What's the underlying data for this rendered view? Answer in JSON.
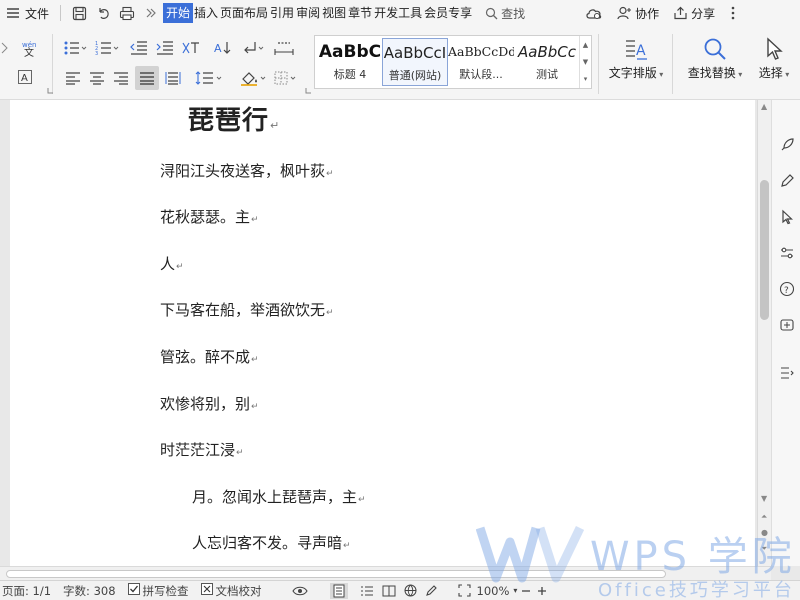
{
  "menubar": {
    "file_label": "文件",
    "tabs": [
      "开始",
      "插入",
      "页面布局",
      "引用",
      "审阅",
      "视图",
      "章节",
      "开发工具",
      "会员专享"
    ],
    "active_tab": "开始",
    "search_label": "查找",
    "collab_label": "协作",
    "share_label": "分享"
  },
  "ribbon": {
    "styles": [
      {
        "preview": "AaBbC",
        "name": "标题 4"
      },
      {
        "preview": "AaBbCcI",
        "name": "普通(网站)"
      },
      {
        "preview": "AaBbCcDd",
        "name": "默认段..."
      },
      {
        "preview": "AaBbCc",
        "name": "测试"
      }
    ],
    "text_layout_label": "文字排版",
    "find_replace_label": "查找替换",
    "select_label": "选择"
  },
  "document": {
    "title": "琵琶行",
    "paragraphs": [
      "浔阳江头夜送客，枫叶荻",
      "花秋瑟瑟。主",
      "人",
      "下马客在船，举酒欲饮无",
      "管弦。醉不成",
      "欢惨将别，别",
      "时茫茫江浸",
      "月。忽闻水上琵琶声，主",
      "人忘归客不发。寻声暗"
    ],
    "paragraph_mark": "↵"
  },
  "statusbar": {
    "page": "页面: 1/1",
    "word_count": "字数: 308",
    "spell_check": "拼写检查",
    "doc_check": "文档校对",
    "zoom": "100%"
  },
  "watermark": {
    "brand": "WPS 学院",
    "slogan": "Office技巧学习平台"
  },
  "colors": {
    "accent": "#3b6fd8",
    "watermark": "#82aae6"
  }
}
